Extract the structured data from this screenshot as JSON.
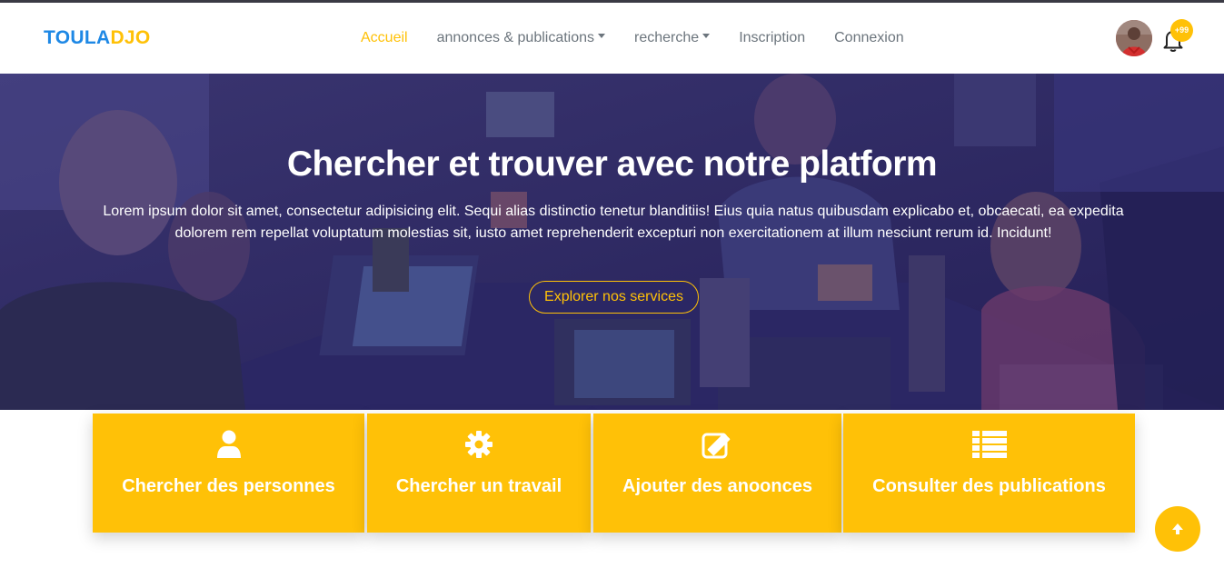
{
  "brand": {
    "part1": "TOULA",
    "part2": "DJO"
  },
  "nav": {
    "items": [
      {
        "label": "Accueil",
        "active": true,
        "dropdown": false
      },
      {
        "label": "annonces & publications",
        "active": false,
        "dropdown": true
      },
      {
        "label": "recherche",
        "active": false,
        "dropdown": true
      },
      {
        "label": "Inscription",
        "active": false,
        "dropdown": false
      },
      {
        "label": "Connexion",
        "active": false,
        "dropdown": false
      }
    ],
    "notification_badge": "+99",
    "avatar_icon": "user-avatar",
    "bell_icon": "bell-icon"
  },
  "hero": {
    "title": "Chercher et trouver avec notre platform",
    "text": "Lorem ipsum dolor sit amet, consectetur adipisicing elit. Sequi alias distinctio tenetur blanditiis! Eius quia natus quibusdam explicabo et, obcaecati, ea expedita dolorem rem repellat voluptatum molestias sit, iusto amet reprehenderit excepturi non exercitationem at illum nesciunt rerum id. Incidunt!",
    "button_label": "Explorer nos services"
  },
  "cards": [
    {
      "label": "Chercher des personnes",
      "icon": "user-icon"
    },
    {
      "label": "Chercher un travail",
      "icon": "gear-icon"
    },
    {
      "label": "Ajouter des anoonces",
      "icon": "edit-icon"
    },
    {
      "label": "Consulter des publications",
      "icon": "list-icon"
    }
  ],
  "colors": {
    "accent": "#ffc107",
    "brand_blue": "#1e88e5",
    "hero_overlay": "#2e2a63",
    "nav_text": "#6c757d"
  },
  "scroll_top_icon": "arrow-up-icon"
}
